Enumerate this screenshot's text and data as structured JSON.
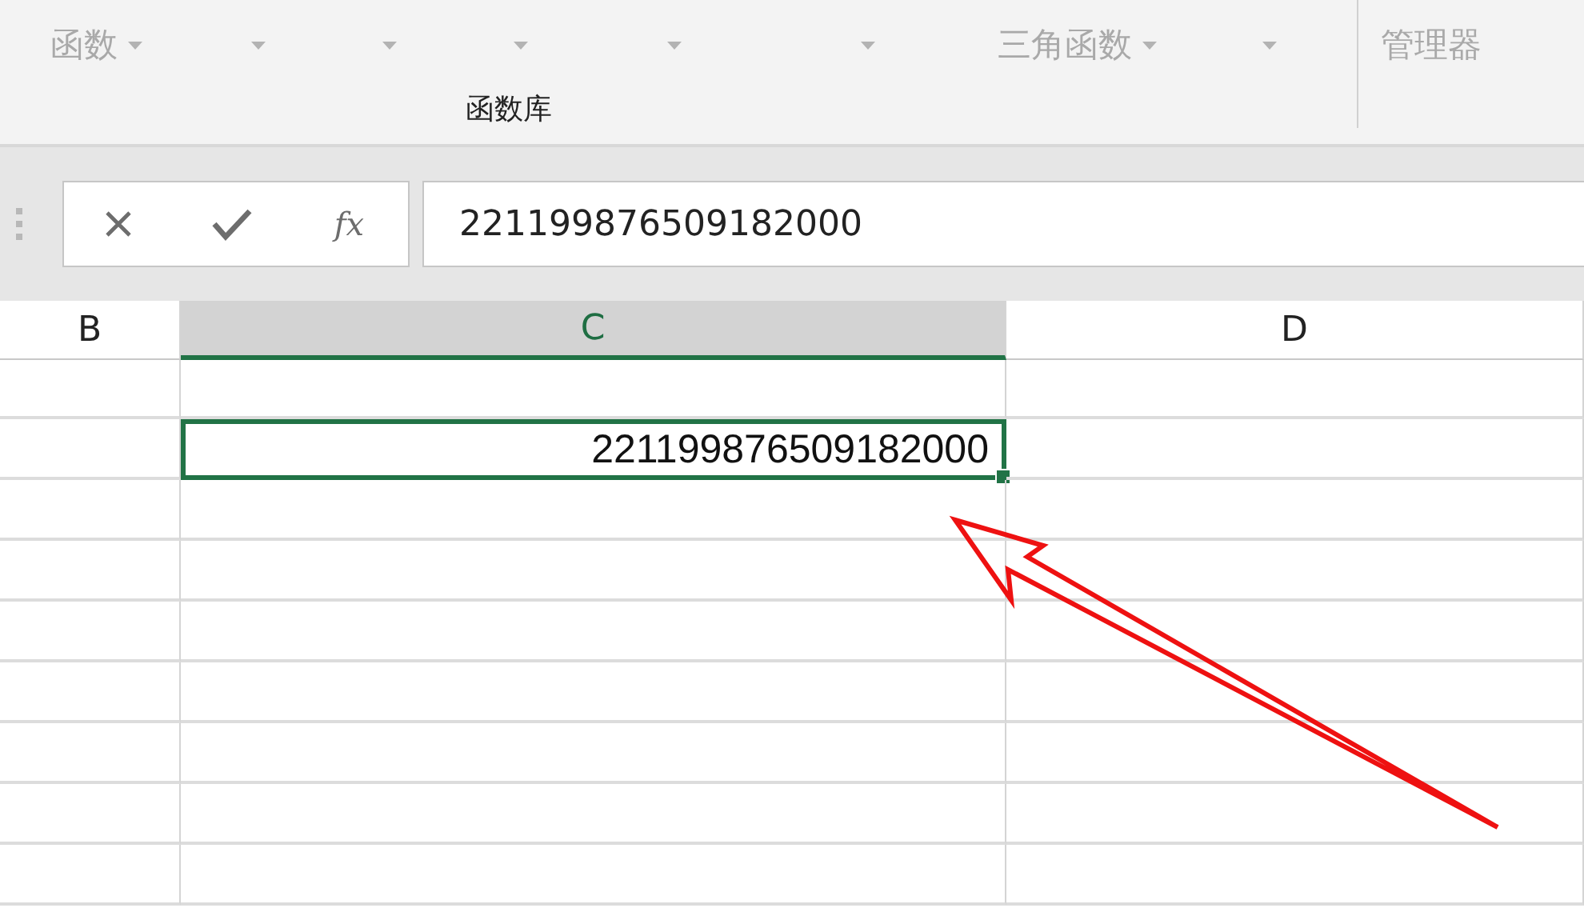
{
  "ribbon": {
    "buttons": [
      {
        "kind": "labeled",
        "label": "函数"
      },
      {
        "kind": "caret-only"
      },
      {
        "kind": "caret-only"
      },
      {
        "kind": "caret-only"
      },
      {
        "kind": "caret-only"
      },
      {
        "kind": "caret-only"
      },
      {
        "kind": "labeled",
        "label": "三角函数"
      },
      {
        "kind": "caret-only"
      }
    ],
    "group_label": "函数库",
    "name_manager": {
      "label": "管理器"
    }
  },
  "formula_bar": {
    "fx": "fx",
    "value": "221199876509182000"
  },
  "columns": [
    {
      "label": "B",
      "selected": false
    },
    {
      "label": "C",
      "selected": true
    },
    {
      "label": "D",
      "selected": false
    }
  ],
  "rows": [
    {
      "cells": [
        {
          "selected": false
        },
        {
          "selected": false
        },
        {
          "selected": false
        }
      ]
    },
    {
      "cells": [
        {
          "selected": false
        },
        {
          "value": "221199876509182000",
          "selected": true
        },
        {
          "selected": false
        }
      ]
    },
    {
      "cells": [
        {
          "selected": false
        },
        {
          "selected": false
        },
        {
          "selected": false
        }
      ]
    },
    {
      "cells": [
        {
          "selected": false
        },
        {
          "selected": false
        },
        {
          "selected": false
        }
      ]
    },
    {
      "cells": [
        {
          "selected": false
        },
        {
          "selected": false
        },
        {
          "selected": false
        }
      ]
    },
    {
      "cells": [
        {
          "selected": false
        },
        {
          "selected": false
        },
        {
          "selected": false
        }
      ]
    },
    {
      "cells": [
        {
          "selected": false
        },
        {
          "selected": false
        },
        {
          "selected": false
        }
      ]
    },
    {
      "cells": [
        {
          "selected": false
        },
        {
          "selected": false
        },
        {
          "selected": false
        }
      ]
    },
    {
      "cells": [
        {
          "selected": false
        },
        {
          "selected": false
        },
        {
          "selected": false
        }
      ]
    }
  ]
}
